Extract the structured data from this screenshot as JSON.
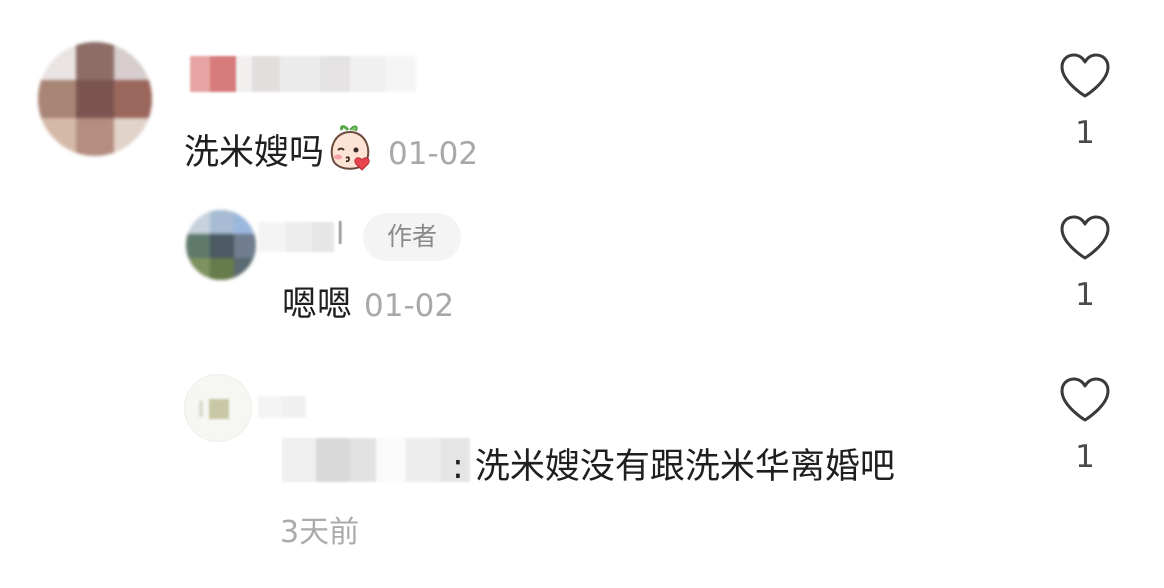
{
  "comments": [
    {
      "text": "洗米嫂吗",
      "time": "01-02",
      "likes": "1",
      "emoji_icon": "blowing-kiss-peach-icon"
    },
    {
      "text": "嗯嗯",
      "time": "01-02",
      "likes": "1",
      "tag": "作者",
      "name_fragment": "l"
    },
    {
      "text": ": 洗米嫂没有跟洗米华离婚吧",
      "time": "3天前",
      "likes": "1"
    }
  ],
  "colors": {
    "text": "#1f1f1f",
    "time": "#a8a8a8",
    "tag_bg": "#f4f4f4",
    "tag_text": "#8a8a8a",
    "heart_stroke": "#3a3a3a"
  }
}
